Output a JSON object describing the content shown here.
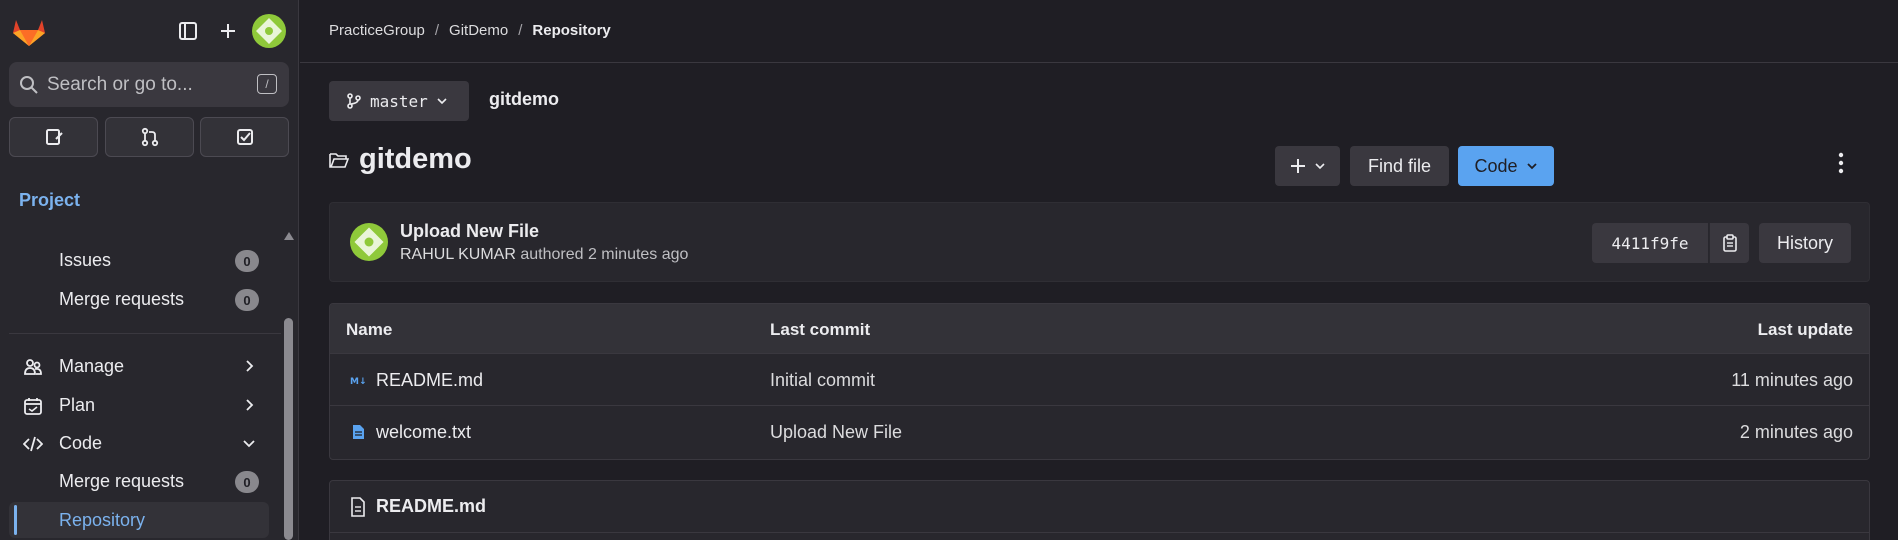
{
  "sidebar": {
    "search_placeholder": "Search or go to...",
    "search_shortcut": "/",
    "section_label": "Project",
    "items": [
      {
        "label": "Issues",
        "badge": "0"
      },
      {
        "label": "Merge requests",
        "badge": "0"
      },
      {
        "label": "Manage"
      },
      {
        "label": "Plan"
      },
      {
        "label": "Code"
      },
      {
        "label": "Merge requests",
        "badge": "0"
      },
      {
        "label": "Repository"
      }
    ]
  },
  "breadcrumb": [
    "PracticeGroup",
    "GitDemo",
    "Repository"
  ],
  "branch": {
    "name": "master"
  },
  "project_path": "gitdemo",
  "repo_title": "gitdemo",
  "toolbar": {
    "find_file": "Find file",
    "code": "Code"
  },
  "commit": {
    "title": "Upload New File",
    "author": "RAHUL KUMAR",
    "meta": "authored 2 minutes ago",
    "sha": "4411f9fe",
    "history": "History"
  },
  "table": {
    "headers": {
      "name": "Name",
      "last_commit": "Last commit",
      "last_update": "Last update"
    },
    "rows": [
      {
        "name": "README.md",
        "commit": "Initial commit",
        "updated": "11 minutes ago"
      },
      {
        "name": "welcome.txt",
        "commit": "Upload New File",
        "updated": "2 minutes ago"
      }
    ]
  },
  "readme": {
    "title": "README.md"
  },
  "colors": {
    "accent": "#5aa3f0",
    "project_label": "#7bb2ee",
    "logo": "#e24329",
    "avatar": "#8fc93a"
  }
}
